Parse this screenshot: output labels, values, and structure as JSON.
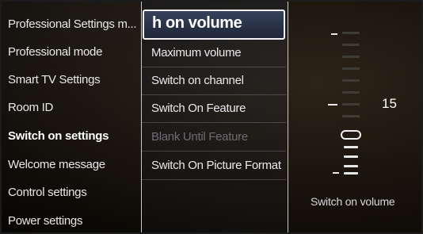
{
  "left_menu": {
    "items": [
      {
        "label": "Professional Settings m..."
      },
      {
        "label": "Professional mode"
      },
      {
        "label": "Smart TV Settings"
      },
      {
        "label": "Room ID"
      },
      {
        "label": "Switch on settings",
        "active": true
      },
      {
        "label": "Welcome message"
      },
      {
        "label": "Control settings"
      },
      {
        "label": "Power settings"
      }
    ]
  },
  "sub_menu": {
    "selected_label": "h on volume",
    "items": [
      {
        "label": "Maximum volume"
      },
      {
        "label": "Switch on channel"
      },
      {
        "label": "Switch On Feature"
      },
      {
        "label": "Blank Until Feature",
        "disabled": true
      },
      {
        "label": "Switch On Picture Format"
      }
    ]
  },
  "volume_panel": {
    "value": "15",
    "caption": "Switch on volume",
    "level_fraction": 0.625
  },
  "colors": {
    "highlight_border": "#f2f2f4",
    "disabled_text": "#6c6e76",
    "background": "#1a140c"
  }
}
